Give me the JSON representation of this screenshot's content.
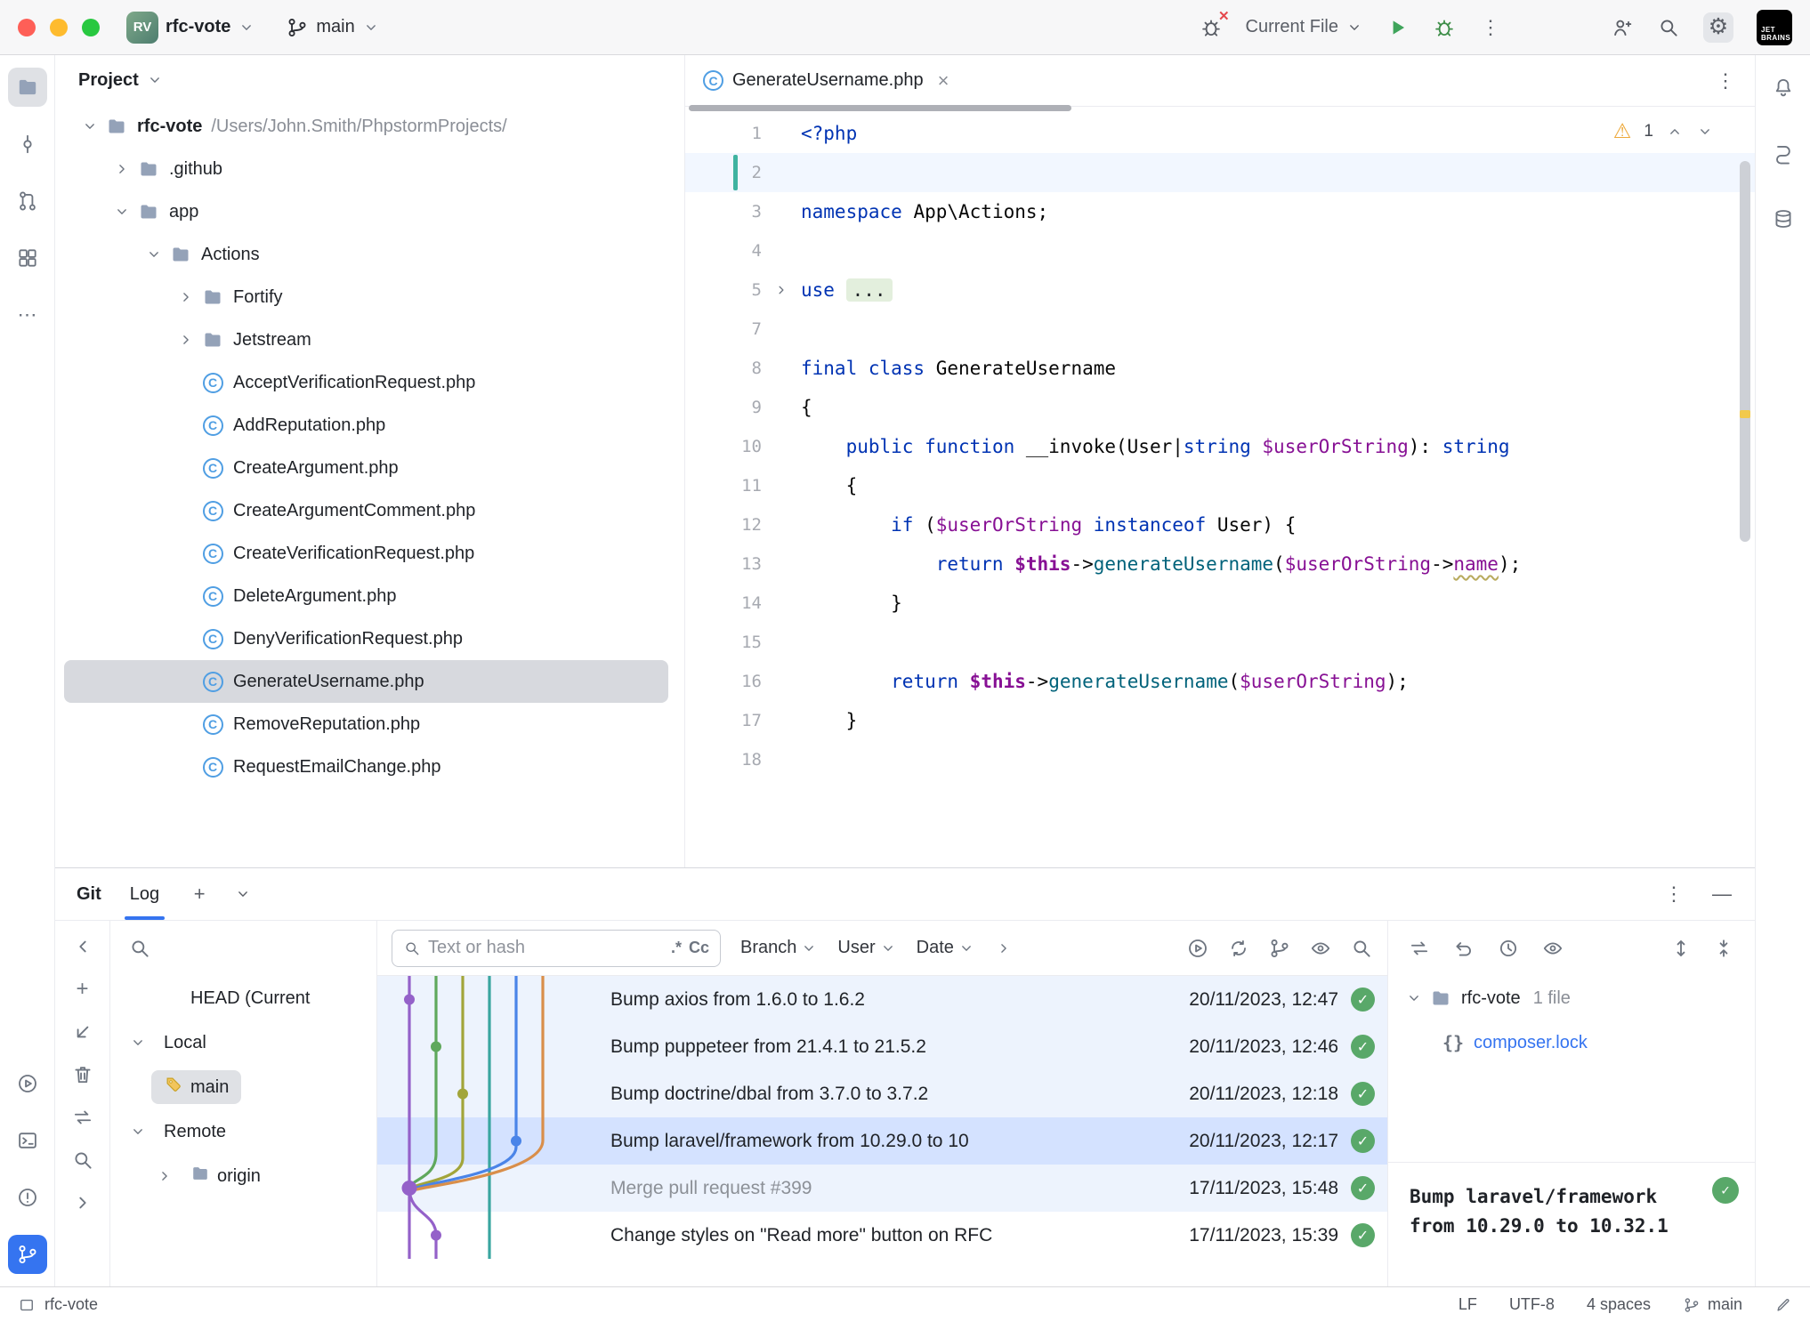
{
  "titlebar": {
    "project_badge": "RV",
    "project_name": "rfc-vote",
    "branch_name": "main",
    "run_config": "Current File",
    "logo_line1": "JET",
    "logo_line2": "BRAINS"
  },
  "left_strip": {
    "top": [
      "project-folder-icon",
      "commit-icon",
      "pull-request-icon",
      "structure-icon",
      "more-icon"
    ],
    "bottom": [
      "run-icon",
      "terminal-icon",
      "problems-icon",
      "git-icon"
    ]
  },
  "right_strip": [
    "notifications-icon",
    "ai-assistant-icon",
    "database-icon"
  ],
  "project_panel": {
    "header": "Project",
    "tree": [
      {
        "label": "rfc-vote",
        "suffix": "/Users/John.Smith/PhpstormProjects/",
        "indent": 0,
        "icon": "folder",
        "chevron": "down",
        "bold": true
      },
      {
        "label": ".github",
        "indent": 1,
        "icon": "folder",
        "chevron": "right"
      },
      {
        "label": "app",
        "indent": 1,
        "icon": "folder",
        "chevron": "down"
      },
      {
        "label": "Actions",
        "indent": 2,
        "icon": "folder",
        "chevron": "down"
      },
      {
        "label": "Fortify",
        "indent": 3,
        "icon": "folder",
        "chevron": "right"
      },
      {
        "label": "Jetstream",
        "indent": 3,
        "icon": "folder",
        "chevron": "right"
      },
      {
        "label": "AcceptVerificationRequest.php",
        "indent": 3,
        "icon": "php"
      },
      {
        "label": "AddReputation.php",
        "indent": 3,
        "icon": "php"
      },
      {
        "label": "CreateArgument.php",
        "indent": 3,
        "icon": "php"
      },
      {
        "label": "CreateArgumentComment.php",
        "indent": 3,
        "icon": "php"
      },
      {
        "label": "CreateVerificationRequest.php",
        "indent": 3,
        "icon": "php"
      },
      {
        "label": "DeleteArgument.php",
        "indent": 3,
        "icon": "php"
      },
      {
        "label": "DenyVerificationRequest.php",
        "indent": 3,
        "icon": "php"
      },
      {
        "label": "GenerateUsername.php",
        "indent": 3,
        "icon": "php",
        "selected": true
      },
      {
        "label": "RemoveReputation.php",
        "indent": 3,
        "icon": "php"
      },
      {
        "label": "RequestEmailChange.php",
        "indent": 3,
        "icon": "php"
      }
    ]
  },
  "editor": {
    "tab_title": "GenerateUsername.php",
    "warning_count": "1",
    "code": [
      {
        "n": "1",
        "t": [
          [
            "kw",
            "<?php"
          ]
        ]
      },
      {
        "n": "2",
        "t": [],
        "caret": true
      },
      {
        "n": "3",
        "t": [
          [
            "kw",
            "namespace"
          ],
          [
            "pl",
            " App\\Actions;"
          ]
        ]
      },
      {
        "n": "4",
        "t": []
      },
      {
        "n": "5",
        "t": [
          [
            "kw",
            "use"
          ],
          [
            "pl",
            " "
          ],
          [
            "fold",
            "..."
          ]
        ],
        "fold": true
      },
      {
        "n": "7",
        "t": []
      },
      {
        "n": "8",
        "t": [
          [
            "kw",
            "final class"
          ],
          [
            "pl",
            " GenerateUsername"
          ]
        ]
      },
      {
        "n": "9",
        "t": [
          [
            "pl",
            "{"
          ]
        ]
      },
      {
        "n": "10",
        "t": [
          [
            "pl",
            "    "
          ],
          [
            "kw",
            "public function"
          ],
          [
            "pl",
            " __invoke(User|"
          ],
          [
            "kw",
            "string"
          ],
          [
            "pl",
            " "
          ],
          [
            "var",
            "$userOrString"
          ],
          [
            "pl",
            "): "
          ],
          [
            "kw",
            "string"
          ]
        ]
      },
      {
        "n": "11",
        "t": [
          [
            "pl",
            "    {"
          ]
        ]
      },
      {
        "n": "12",
        "t": [
          [
            "pl",
            "        "
          ],
          [
            "kw",
            "if"
          ],
          [
            "pl",
            " ("
          ],
          [
            "var",
            "$userOrString"
          ],
          [
            "pl",
            " "
          ],
          [
            "kw",
            "instanceof"
          ],
          [
            "pl",
            " User) {"
          ]
        ]
      },
      {
        "n": "13",
        "t": [
          [
            "pl",
            "            "
          ],
          [
            "kw",
            "return"
          ],
          [
            "pl",
            " "
          ],
          [
            "this",
            "$this"
          ],
          [
            "pl",
            "->"
          ],
          [
            "mth",
            "generateUsername"
          ],
          [
            "pl",
            "("
          ],
          [
            "var",
            "$userOrString"
          ],
          [
            "pl",
            "->"
          ],
          [
            "fieldwarn",
            "name"
          ],
          [
            "pl",
            ");"
          ]
        ]
      },
      {
        "n": "14",
        "t": [
          [
            "pl",
            "        }"
          ]
        ]
      },
      {
        "n": "15",
        "t": []
      },
      {
        "n": "16",
        "t": [
          [
            "pl",
            "        "
          ],
          [
            "kw",
            "return"
          ],
          [
            "pl",
            " "
          ],
          [
            "this",
            "$this"
          ],
          [
            "pl",
            "->"
          ],
          [
            "mth",
            "generateUsername"
          ],
          [
            "pl",
            "("
          ],
          [
            "var",
            "$userOrString"
          ],
          [
            "pl",
            ");"
          ]
        ]
      },
      {
        "n": "17",
        "t": [
          [
            "pl",
            "    }"
          ]
        ]
      },
      {
        "n": "18",
        "t": []
      }
    ]
  },
  "git_panel": {
    "title": "Git",
    "tab": "Log",
    "mini_toolbar": [
      "chevron-left-icon",
      "add-icon",
      "checkout-icon",
      "delete-icon",
      "compare-icon",
      "search-icon",
      "chevron-right-icon"
    ],
    "branches": [
      {
        "label": "HEAD (Current",
        "indent": 1
      },
      {
        "label": "Local",
        "indent": 0,
        "chevron": "down"
      },
      {
        "label": "main",
        "indent": 1,
        "icon": "tag",
        "selected": true
      },
      {
        "label": "Remote",
        "indent": 0,
        "chevron": "down"
      },
      {
        "label": "origin",
        "indent": 1,
        "icon": "folder",
        "chevron": "right"
      }
    ],
    "search_placeholder": "Text or hash",
    "regex_toggle": ".*",
    "case_toggle": "Cc",
    "filters": [
      "Branch",
      "User",
      "Date"
    ],
    "log_toolbar_icons": [
      "load-more-icon",
      "refresh-icon",
      "branch-filter-icon",
      "preview-icon",
      "find-icon"
    ],
    "commits": [
      {
        "msg": "Bump axios from 1.6.0 to 1.6.2",
        "date": "20/11/2023, 12:47",
        "bg": "tint"
      },
      {
        "msg": "Bump puppeteer from 21.4.1 to 21.5.2",
        "date": "20/11/2023, 12:46",
        "bg": "tint"
      },
      {
        "msg": "Bump doctrine/dbal from 3.7.0 to 3.7.2",
        "date": "20/11/2023, 12:18",
        "bg": "tint"
      },
      {
        "msg": "Bump laravel/framework from 10.29.0 to 10",
        "date": "20/11/2023, 12:17",
        "bg": "selected"
      },
      {
        "msg": "Merge pull request #399",
        "date": "17/11/2023, 15:48",
        "bg": "tint",
        "muted": true
      },
      {
        "msg": "Change styles on \"Read more\" button on RFC",
        "date": "17/11/2023, 15:39",
        "bg": "plain"
      }
    ],
    "details": {
      "toolbar_left": [
        "compare-icon",
        "rollback-icon",
        "history-icon",
        "preview-diff-icon"
      ],
      "toolbar_right": [
        "expand-all-icon",
        "collapse-all-icon"
      ],
      "root_label": "rfc-vote",
      "file_count": "1 file",
      "file": "composer.lock",
      "commit_message": "Bump laravel/framework from 10.29.0 to 10.32.1"
    }
  },
  "statusbar": {
    "project": "rfc-vote",
    "line_ending": "LF",
    "encoding": "UTF-8",
    "indent": "4 spaces",
    "branch": "main"
  },
  "colors": {
    "accent": "#3574f0",
    "selection_row": "#d4e2ff",
    "tint_row": "#edf3fd",
    "check_green": "#59a869",
    "warning_yellow": "#eda93c"
  }
}
